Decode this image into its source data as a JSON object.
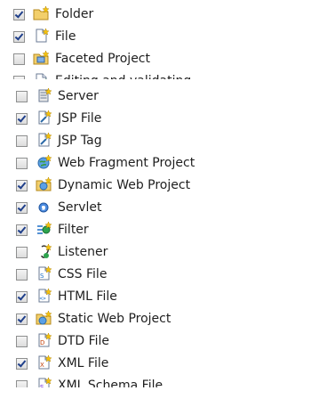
{
  "top_list": [
    {
      "label": "Folder",
      "checked": true,
      "icon": "folder-icon"
    },
    {
      "label": "File",
      "checked": true,
      "icon": "file-icon"
    },
    {
      "label": "Faceted Project",
      "checked": false,
      "icon": "faceted-project-icon"
    },
    {
      "label": "Editing and validating",
      "checked": false,
      "icon": "editing-validating-icon"
    }
  ],
  "bottom_list": [
    {
      "label": "Server",
      "checked": false,
      "icon": "server-icon"
    },
    {
      "label": "JSP File",
      "checked": true,
      "icon": "jsp-file-icon"
    },
    {
      "label": "JSP Tag",
      "checked": false,
      "icon": "jsp-tag-icon"
    },
    {
      "label": "Web Fragment Project",
      "checked": false,
      "icon": "web-fragment-project-icon"
    },
    {
      "label": "Dynamic Web Project",
      "checked": true,
      "icon": "dynamic-web-project-icon"
    },
    {
      "label": "Servlet",
      "checked": true,
      "icon": "servlet-icon"
    },
    {
      "label": "Filter",
      "checked": true,
      "icon": "filter-icon"
    },
    {
      "label": "Listener",
      "checked": false,
      "icon": "listener-icon"
    },
    {
      "label": "CSS File",
      "checked": false,
      "icon": "css-file-icon"
    },
    {
      "label": "HTML File",
      "checked": true,
      "icon": "html-file-icon"
    },
    {
      "label": "Static Web Project",
      "checked": true,
      "icon": "static-web-project-icon"
    },
    {
      "label": "DTD File",
      "checked": false,
      "icon": "dtd-file-icon"
    },
    {
      "label": "XML File",
      "checked": true,
      "icon": "xml-file-icon"
    },
    {
      "label": "XML Schema File",
      "checked": false,
      "icon": "xml-schema-file-icon"
    }
  ]
}
